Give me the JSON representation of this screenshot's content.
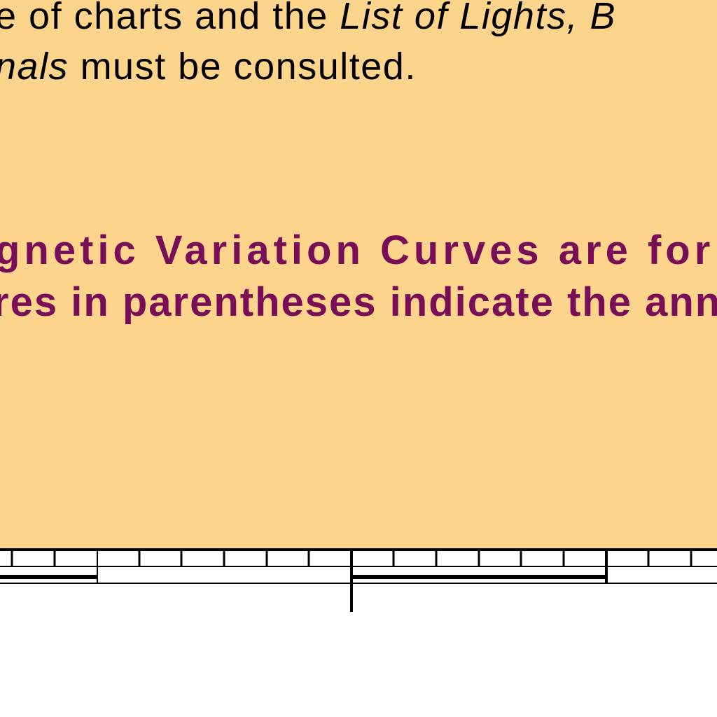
{
  "colors": {
    "panel_fill": "#fcd48c",
    "body_text": "#000000",
    "magenta_text": "#7a0d58",
    "border_line": "#000000",
    "page_background": "#ffffff"
  },
  "note": {
    "line1": {
      "lead": "e of charts and the ",
      "italic": "List of Lights, B"
    },
    "line2": {
      "italic": "nals",
      "rest": " must be consulted."
    }
  },
  "magvar_note": {
    "line1": "gnetic Variation Curves are for",
    "line2": "res in parentheses indicate the ann"
  }
}
